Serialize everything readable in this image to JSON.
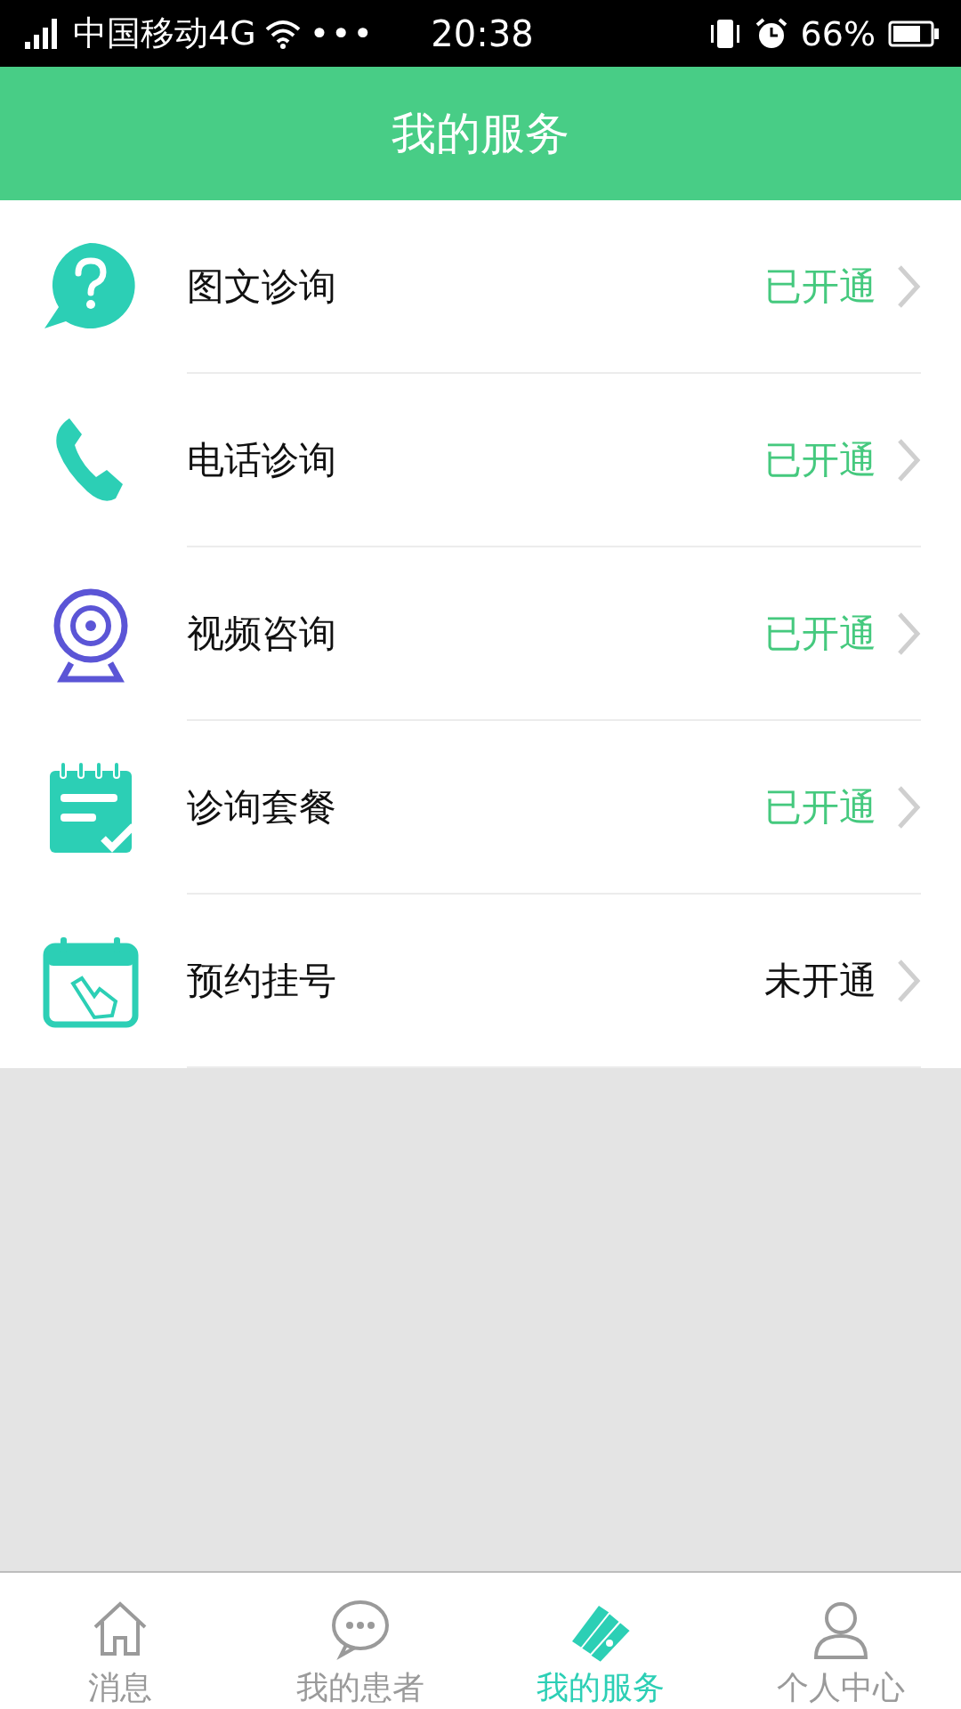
{
  "status_bar": {
    "carrier": "中国移动4G",
    "more": "•••",
    "time": "20:38",
    "battery": "66%"
  },
  "header": {
    "title": "我的服务"
  },
  "services": [
    {
      "label": "图文诊询",
      "status": "已开通",
      "enabled": true
    },
    {
      "label": "电话诊询",
      "status": "已开通",
      "enabled": true
    },
    {
      "label": "视频咨询",
      "status": "已开通",
      "enabled": true
    },
    {
      "label": "诊询套餐",
      "status": "已开通",
      "enabled": true
    },
    {
      "label": "预约挂号",
      "status": "未开通",
      "enabled": false
    }
  ],
  "tabs": [
    {
      "label": "消息",
      "selected": false
    },
    {
      "label": "我的患者",
      "selected": false
    },
    {
      "label": "我的服务",
      "selected": true
    },
    {
      "label": "个人中心",
      "selected": false
    }
  ]
}
